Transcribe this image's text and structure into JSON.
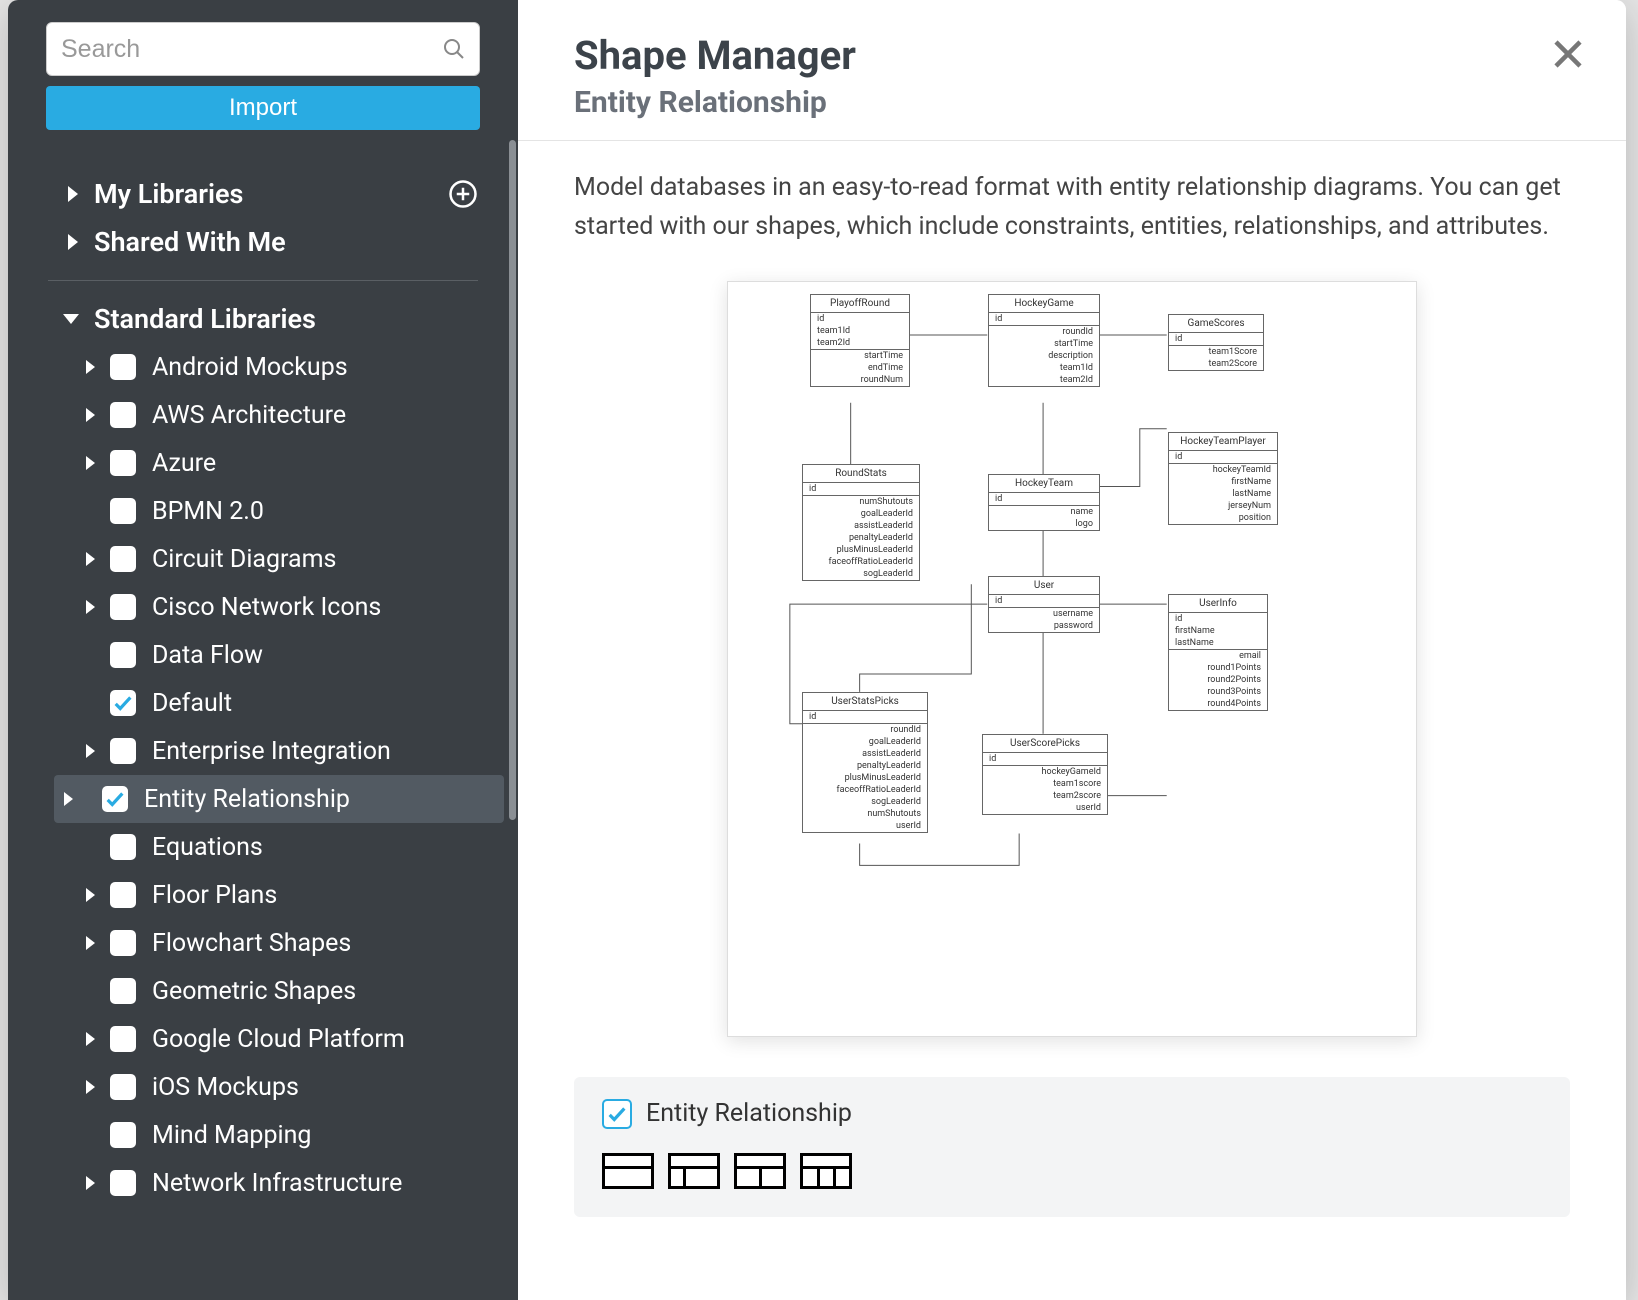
{
  "sidebar": {
    "search_placeholder": "Search",
    "import_label": "Import",
    "groups": {
      "my_libraries": "My Libraries",
      "shared_with_me": "Shared With Me",
      "standard_libraries": "Standard Libraries"
    },
    "libs": [
      {
        "label": "Android Mockups",
        "checked": false,
        "caret": true
      },
      {
        "label": "AWS Architecture",
        "checked": false,
        "caret": true
      },
      {
        "label": "Azure",
        "checked": false,
        "caret": true
      },
      {
        "label": "BPMN 2.0",
        "checked": false,
        "caret": false
      },
      {
        "label": "Circuit Diagrams",
        "checked": false,
        "caret": true
      },
      {
        "label": "Cisco Network Icons",
        "checked": false,
        "caret": true
      },
      {
        "label": "Data Flow",
        "checked": false,
        "caret": false
      },
      {
        "label": "Default",
        "checked": true,
        "caret": false
      },
      {
        "label": "Enterprise Integration",
        "checked": false,
        "caret": true
      },
      {
        "label": "Entity Relationship",
        "checked": true,
        "caret": true,
        "selected": true
      },
      {
        "label": "Equations",
        "checked": false,
        "caret": false
      },
      {
        "label": "Floor Plans",
        "checked": false,
        "caret": true
      },
      {
        "label": "Flowchart Shapes",
        "checked": false,
        "caret": true
      },
      {
        "label": "Geometric Shapes",
        "checked": false,
        "caret": false
      },
      {
        "label": "Google Cloud Platform",
        "checked": false,
        "caret": true
      },
      {
        "label": "iOS Mockups",
        "checked": false,
        "caret": true
      },
      {
        "label": "Mind Mapping",
        "checked": false,
        "caret": false
      },
      {
        "label": "Network Infrastructure",
        "checked": false,
        "caret": true
      }
    ]
  },
  "main": {
    "title": "Shape Manager",
    "subtitle": "Entity Relationship",
    "description": "Model databases in an easy-to-read format with entity relationship diagrams. You can get started with our shapes, which include constraints, entities, relationships, and attributes.",
    "footer_label": "Entity Relationship"
  },
  "erd": {
    "PlayoffRound": [
      "id",
      "team1Id",
      "team2Id",
      "startTime",
      "endTime",
      "roundNum"
    ],
    "HockeyGame": [
      "id",
      "roundId",
      "startTime",
      "description",
      "team1Id",
      "team2Id"
    ],
    "GameScores": [
      "id",
      "team1Score",
      "team2Score"
    ],
    "RoundStats": [
      "id",
      "numShutouts",
      "goalLeaderId",
      "assistLeaderId",
      "penaltyLeaderId",
      "plusMinusLeaderId",
      "faceoffRatioLeaderId",
      "sogLeaderId"
    ],
    "HockeyTeam": [
      "id",
      "name",
      "logo"
    ],
    "HockeyTeamPlayer": [
      "id",
      "hockeyTeamId",
      "firstName",
      "lastName",
      "jerseyNum",
      "position"
    ],
    "User": [
      "id",
      "username",
      "password"
    ],
    "UserInfo": [
      "id",
      "firstName",
      "lastName",
      "email",
      "round1Points",
      "round2Points",
      "round3Points",
      "round4Points"
    ],
    "UserStatsPicks": [
      "id",
      "roundId",
      "goalLeaderId",
      "assistLeaderId",
      "penaltyLeaderId",
      "plusMinusLeaderId",
      "faceoffRatioLeaderId",
      "sogLeaderId",
      "numShutouts",
      "userId"
    ],
    "UserScorePicks": [
      "id",
      "hockeyGameId",
      "team1score",
      "team2score",
      "userId"
    ]
  }
}
